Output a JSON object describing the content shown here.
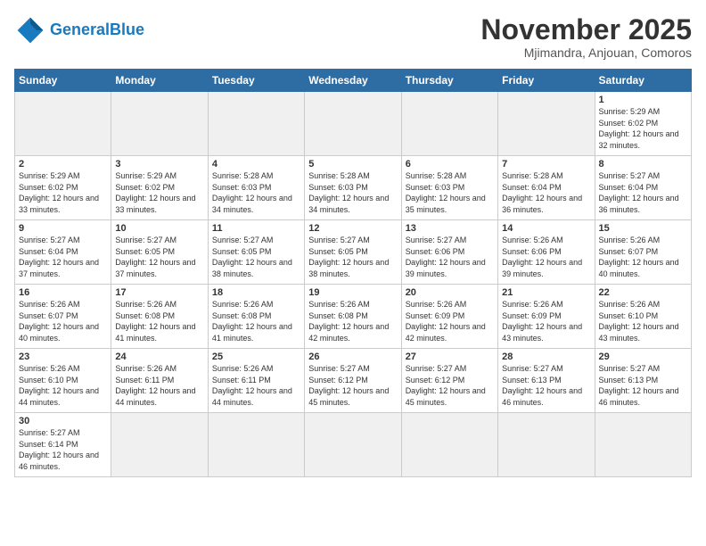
{
  "header": {
    "logo_general": "General",
    "logo_blue": "Blue",
    "month_title": "November 2025",
    "subtitle": "Mjimandra, Anjouan, Comoros"
  },
  "weekdays": [
    "Sunday",
    "Monday",
    "Tuesday",
    "Wednesday",
    "Thursday",
    "Friday",
    "Saturday"
  ],
  "weeks": [
    [
      {
        "day": "",
        "empty": true
      },
      {
        "day": "",
        "empty": true
      },
      {
        "day": "",
        "empty": true
      },
      {
        "day": "",
        "empty": true
      },
      {
        "day": "",
        "empty": true
      },
      {
        "day": "",
        "empty": true
      },
      {
        "day": "1",
        "sunrise": "Sunrise: 5:29 AM",
        "sunset": "Sunset: 6:02 PM",
        "daylight": "Daylight: 12 hours and 32 minutes."
      }
    ],
    [
      {
        "day": "2",
        "sunrise": "Sunrise: 5:29 AM",
        "sunset": "Sunset: 6:02 PM",
        "daylight": "Daylight: 12 hours and 33 minutes."
      },
      {
        "day": "3",
        "sunrise": "Sunrise: 5:29 AM",
        "sunset": "Sunset: 6:02 PM",
        "daylight": "Daylight: 12 hours and 33 minutes."
      },
      {
        "day": "4",
        "sunrise": "Sunrise: 5:28 AM",
        "sunset": "Sunset: 6:03 PM",
        "daylight": "Daylight: 12 hours and 34 minutes."
      },
      {
        "day": "5",
        "sunrise": "Sunrise: 5:28 AM",
        "sunset": "Sunset: 6:03 PM",
        "daylight": "Daylight: 12 hours and 34 minutes."
      },
      {
        "day": "6",
        "sunrise": "Sunrise: 5:28 AM",
        "sunset": "Sunset: 6:03 PM",
        "daylight": "Daylight: 12 hours and 35 minutes."
      },
      {
        "day": "7",
        "sunrise": "Sunrise: 5:28 AM",
        "sunset": "Sunset: 6:04 PM",
        "daylight": "Daylight: 12 hours and 36 minutes."
      },
      {
        "day": "8",
        "sunrise": "Sunrise: 5:27 AM",
        "sunset": "Sunset: 6:04 PM",
        "daylight": "Daylight: 12 hours and 36 minutes."
      }
    ],
    [
      {
        "day": "9",
        "sunrise": "Sunrise: 5:27 AM",
        "sunset": "Sunset: 6:04 PM",
        "daylight": "Daylight: 12 hours and 37 minutes."
      },
      {
        "day": "10",
        "sunrise": "Sunrise: 5:27 AM",
        "sunset": "Sunset: 6:05 PM",
        "daylight": "Daylight: 12 hours and 37 minutes."
      },
      {
        "day": "11",
        "sunrise": "Sunrise: 5:27 AM",
        "sunset": "Sunset: 6:05 PM",
        "daylight": "Daylight: 12 hours and 38 minutes."
      },
      {
        "day": "12",
        "sunrise": "Sunrise: 5:27 AM",
        "sunset": "Sunset: 6:05 PM",
        "daylight": "Daylight: 12 hours and 38 minutes."
      },
      {
        "day": "13",
        "sunrise": "Sunrise: 5:27 AM",
        "sunset": "Sunset: 6:06 PM",
        "daylight": "Daylight: 12 hours and 39 minutes."
      },
      {
        "day": "14",
        "sunrise": "Sunrise: 5:26 AM",
        "sunset": "Sunset: 6:06 PM",
        "daylight": "Daylight: 12 hours and 39 minutes."
      },
      {
        "day": "15",
        "sunrise": "Sunrise: 5:26 AM",
        "sunset": "Sunset: 6:07 PM",
        "daylight": "Daylight: 12 hours and 40 minutes."
      }
    ],
    [
      {
        "day": "16",
        "sunrise": "Sunrise: 5:26 AM",
        "sunset": "Sunset: 6:07 PM",
        "daylight": "Daylight: 12 hours and 40 minutes."
      },
      {
        "day": "17",
        "sunrise": "Sunrise: 5:26 AM",
        "sunset": "Sunset: 6:08 PM",
        "daylight": "Daylight: 12 hours and 41 minutes."
      },
      {
        "day": "18",
        "sunrise": "Sunrise: 5:26 AM",
        "sunset": "Sunset: 6:08 PM",
        "daylight": "Daylight: 12 hours and 41 minutes."
      },
      {
        "day": "19",
        "sunrise": "Sunrise: 5:26 AM",
        "sunset": "Sunset: 6:08 PM",
        "daylight": "Daylight: 12 hours and 42 minutes."
      },
      {
        "day": "20",
        "sunrise": "Sunrise: 5:26 AM",
        "sunset": "Sunset: 6:09 PM",
        "daylight": "Daylight: 12 hours and 42 minutes."
      },
      {
        "day": "21",
        "sunrise": "Sunrise: 5:26 AM",
        "sunset": "Sunset: 6:09 PM",
        "daylight": "Daylight: 12 hours and 43 minutes."
      },
      {
        "day": "22",
        "sunrise": "Sunrise: 5:26 AM",
        "sunset": "Sunset: 6:10 PM",
        "daylight": "Daylight: 12 hours and 43 minutes."
      }
    ],
    [
      {
        "day": "23",
        "sunrise": "Sunrise: 5:26 AM",
        "sunset": "Sunset: 6:10 PM",
        "daylight": "Daylight: 12 hours and 44 minutes."
      },
      {
        "day": "24",
        "sunrise": "Sunrise: 5:26 AM",
        "sunset": "Sunset: 6:11 PM",
        "daylight": "Daylight: 12 hours and 44 minutes."
      },
      {
        "day": "25",
        "sunrise": "Sunrise: 5:26 AM",
        "sunset": "Sunset: 6:11 PM",
        "daylight": "Daylight: 12 hours and 44 minutes."
      },
      {
        "day": "26",
        "sunrise": "Sunrise: 5:27 AM",
        "sunset": "Sunset: 6:12 PM",
        "daylight": "Daylight: 12 hours and 45 minutes."
      },
      {
        "day": "27",
        "sunrise": "Sunrise: 5:27 AM",
        "sunset": "Sunset: 6:12 PM",
        "daylight": "Daylight: 12 hours and 45 minutes."
      },
      {
        "day": "28",
        "sunrise": "Sunrise: 5:27 AM",
        "sunset": "Sunset: 6:13 PM",
        "daylight": "Daylight: 12 hours and 46 minutes."
      },
      {
        "day": "29",
        "sunrise": "Sunrise: 5:27 AM",
        "sunset": "Sunset: 6:13 PM",
        "daylight": "Daylight: 12 hours and 46 minutes."
      }
    ],
    [
      {
        "day": "30",
        "sunrise": "Sunrise: 5:27 AM",
        "sunset": "Sunset: 6:14 PM",
        "daylight": "Daylight: 12 hours and 46 minutes."
      },
      {
        "day": "",
        "empty": true
      },
      {
        "day": "",
        "empty": true
      },
      {
        "day": "",
        "empty": true
      },
      {
        "day": "",
        "empty": true
      },
      {
        "day": "",
        "empty": true
      },
      {
        "day": "",
        "empty": true
      }
    ]
  ]
}
